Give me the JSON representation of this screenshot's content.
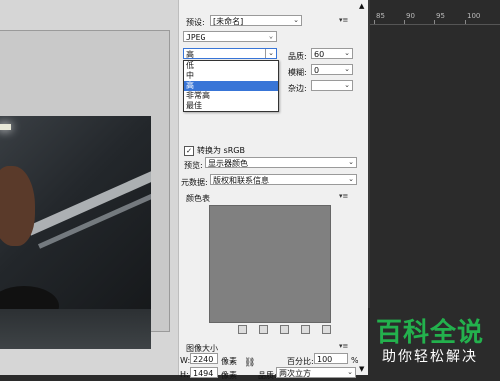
{
  "preset": {
    "label": "预设:",
    "value": "[未命名]"
  },
  "format": {
    "value": "JPEG"
  },
  "quality_level": {
    "value": "高",
    "options": [
      "低",
      "中",
      "高",
      "非常高",
      "最佳"
    ],
    "selected": "高"
  },
  "quality": {
    "label": "品质:",
    "value": "60"
  },
  "blur": {
    "label": "模糊:",
    "value": "0"
  },
  "matte": {
    "label": "杂边:",
    "value": ""
  },
  "convert": {
    "label": "转换为 sRGB",
    "checked": true
  },
  "preview": {
    "label": "预览:",
    "value": "显示器颜色"
  },
  "metadata": {
    "label": "元数据:",
    "value": "版权和联系信息"
  },
  "color_table": {
    "label": "颜色表"
  },
  "image_size": {
    "label": "图像大小",
    "width": "2240",
    "height": "1494",
    "unit": "像素",
    "percent_label": "百分比:",
    "percent": "100",
    "percent_unit": "%",
    "quality_label": "品质:",
    "quality_value": "两次立方"
  },
  "ruler": {
    "ticks": [
      "85",
      "90",
      "95",
      "100"
    ]
  },
  "watermark": {
    "title": "百科全说",
    "subtitle": "助你轻松解决"
  }
}
